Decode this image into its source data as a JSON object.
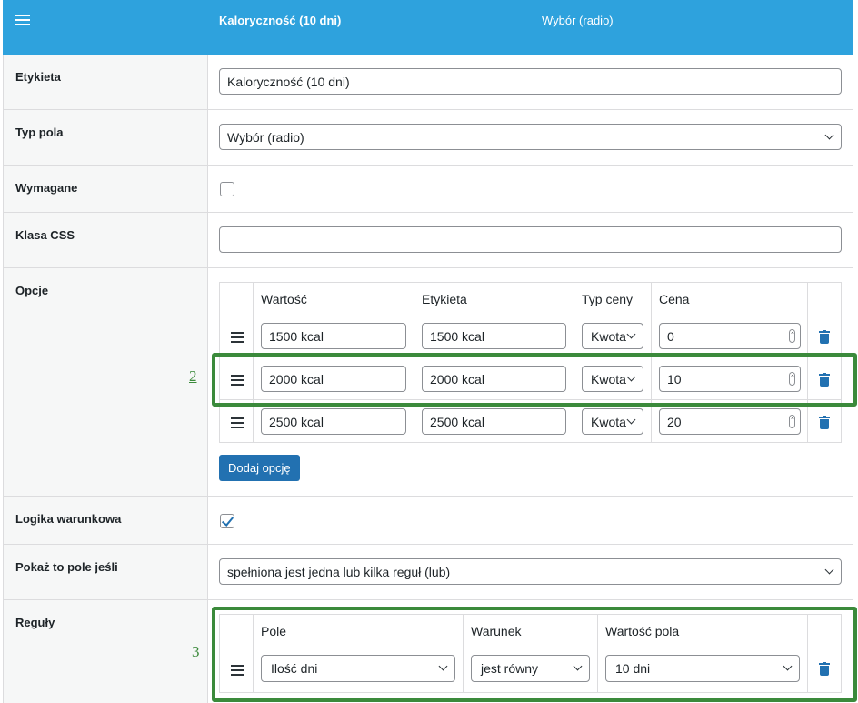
{
  "header": {
    "field_title": "Kaloryczność (10 dni)",
    "field_type": "Wybór (radio)"
  },
  "form": {
    "label_row": {
      "label": "Etykieta",
      "value": "Kaloryczność (10 dni)"
    },
    "type_row": {
      "label": "Typ pola",
      "value": "Wybór (radio)"
    },
    "required_row": {
      "label": "Wymagane",
      "checked": false
    },
    "css_row": {
      "label": "Klasa CSS",
      "value": ""
    },
    "options_row": {
      "label": "Opcje",
      "headers": [
        "Wartość",
        "Etykieta",
        "Typ ceny",
        "Cena"
      ],
      "rows": [
        {
          "value": "1500 kcal",
          "label": "1500 kcal",
          "price_type": "Kwota",
          "price": "0"
        },
        {
          "value": "2000 kcal",
          "label": "2000 kcal",
          "price_type": "Kwota",
          "price": "10"
        },
        {
          "value": "2500 kcal",
          "label": "2500 kcal",
          "price_type": "Kwota",
          "price": "20"
        }
      ],
      "add_button": "Dodaj opcję"
    },
    "logic_row": {
      "label": "Logika warunkowa",
      "checked": true
    },
    "show_if_row": {
      "label": "Pokaż to pole jeśli",
      "value": "spełniona jest jedna lub kilka reguł (lub)"
    },
    "rules_row": {
      "label": "Reguły",
      "headers": [
        "Pole",
        "Warunek",
        "Wartość pola"
      ],
      "rows": [
        {
          "field": "Ilość dni",
          "condition": "jest równy",
          "value": "10 dni"
        }
      ]
    }
  },
  "annotations": {
    "a2": "2",
    "a3": "3"
  },
  "colors": {
    "header": "#2ea2dd",
    "accent": "#2271b1",
    "highlight": "#3b8a3b"
  }
}
